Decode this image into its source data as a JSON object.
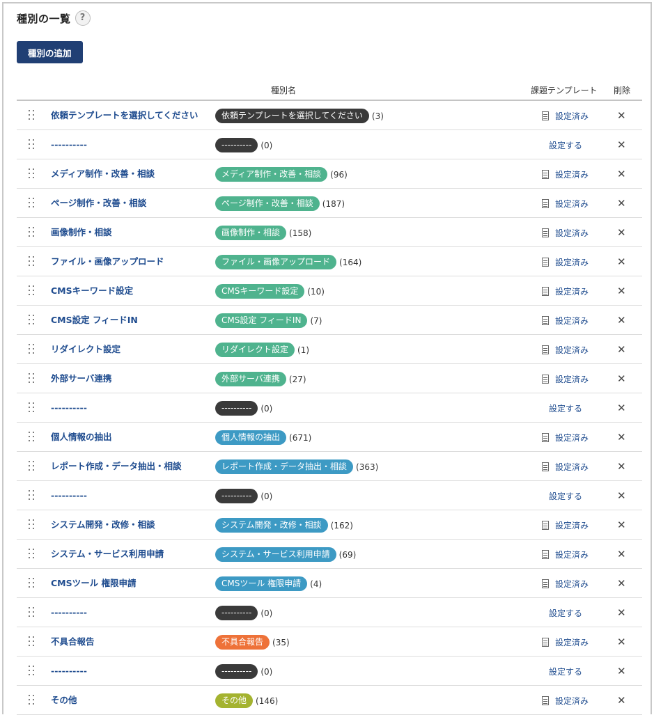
{
  "header": {
    "title": "種別の一覧",
    "help_label": "?"
  },
  "add_button": {
    "label": "種別の追加"
  },
  "columns": {
    "name": "種別名",
    "template": "課題テンプレート",
    "delete": "削除"
  },
  "labels": {
    "template_set": "設定済み",
    "template_unset": "設定する",
    "delete_glyph": "✕"
  },
  "colors": {
    "black": "#3a3a3a",
    "green": "#4fb38e",
    "blue": "#3d9ac4",
    "orange": "#ee7239",
    "olive": "#a4b330",
    "button": "#203f74",
    "link": "#1f4c8f"
  },
  "rows": [
    {
      "name": "依頼テンプレートを選択してください",
      "badge": "依頼テンプレートを選択してください",
      "count": "(3)",
      "color": "#3a3a3a",
      "template": "set"
    },
    {
      "name": "----------",
      "badge": "----------",
      "count": "(0)",
      "color": "#3a3a3a",
      "template": "unset"
    },
    {
      "name": "メディア制作・改善・相談",
      "badge": "メディア制作・改善・相談",
      "count": "(96)",
      "color": "#4fb38e",
      "template": "set"
    },
    {
      "name": "ページ制作・改善・相談",
      "badge": "ページ制作・改善・相談",
      "count": "(187)",
      "color": "#4fb38e",
      "template": "set"
    },
    {
      "name": "画像制作・相談",
      "badge": "画像制作・相談",
      "count": "(158)",
      "color": "#4fb38e",
      "template": "set"
    },
    {
      "name": "ファイル・画像アップロード",
      "badge": "ファイル・画像アップロード",
      "count": "(164)",
      "color": "#4fb38e",
      "template": "set"
    },
    {
      "name": "CMSキーワード設定",
      "badge": "CMSキーワード設定",
      "count": "(10)",
      "color": "#4fb38e",
      "template": "set"
    },
    {
      "name": "CMS設定 フィードIN",
      "badge": "CMS設定 フィードIN",
      "count": "(7)",
      "color": "#4fb38e",
      "template": "set"
    },
    {
      "name": "リダイレクト設定",
      "badge": "リダイレクト設定",
      "count": "(1)",
      "color": "#4fb38e",
      "template": "set"
    },
    {
      "name": "外部サーバ連携",
      "badge": "外部サーバ連携",
      "count": "(27)",
      "color": "#4fb38e",
      "template": "set"
    },
    {
      "name": "----------",
      "badge": "----------",
      "count": "(0)",
      "color": "#3a3a3a",
      "template": "unset"
    },
    {
      "name": "個人情報の抽出",
      "badge": "個人情報の抽出",
      "count": "(671)",
      "color": "#3d9ac4",
      "template": "set"
    },
    {
      "name": "レポート作成・データ抽出・相談",
      "badge": "レポート作成・データ抽出・相談",
      "count": "(363)",
      "color": "#3d9ac4",
      "template": "set"
    },
    {
      "name": "----------",
      "badge": "----------",
      "count": "(0)",
      "color": "#3a3a3a",
      "template": "unset"
    },
    {
      "name": "システム開発・改修・相談",
      "badge": "システム開発・改修・相談",
      "count": "(162)",
      "color": "#3d9ac4",
      "template": "set"
    },
    {
      "name": "システム・サービス利用申請",
      "badge": "システム・サービス利用申請",
      "count": "(69)",
      "color": "#3d9ac4",
      "template": "set"
    },
    {
      "name": "CMSツール 権限申請",
      "badge": "CMSツール 権限申請",
      "count": "(4)",
      "color": "#3d9ac4",
      "template": "set"
    },
    {
      "name": "----------",
      "badge": "----------",
      "count": "(0)",
      "color": "#3a3a3a",
      "template": "unset"
    },
    {
      "name": "不具合報告",
      "badge": "不具合報告",
      "count": "(35)",
      "color": "#ee7239",
      "template": "set"
    },
    {
      "name": "----------",
      "badge": "----------",
      "count": "(0)",
      "color": "#3a3a3a",
      "template": "unset"
    },
    {
      "name": "その他",
      "badge": "その他",
      "count": "(146)",
      "color": "#a4b330",
      "template": "set"
    }
  ]
}
